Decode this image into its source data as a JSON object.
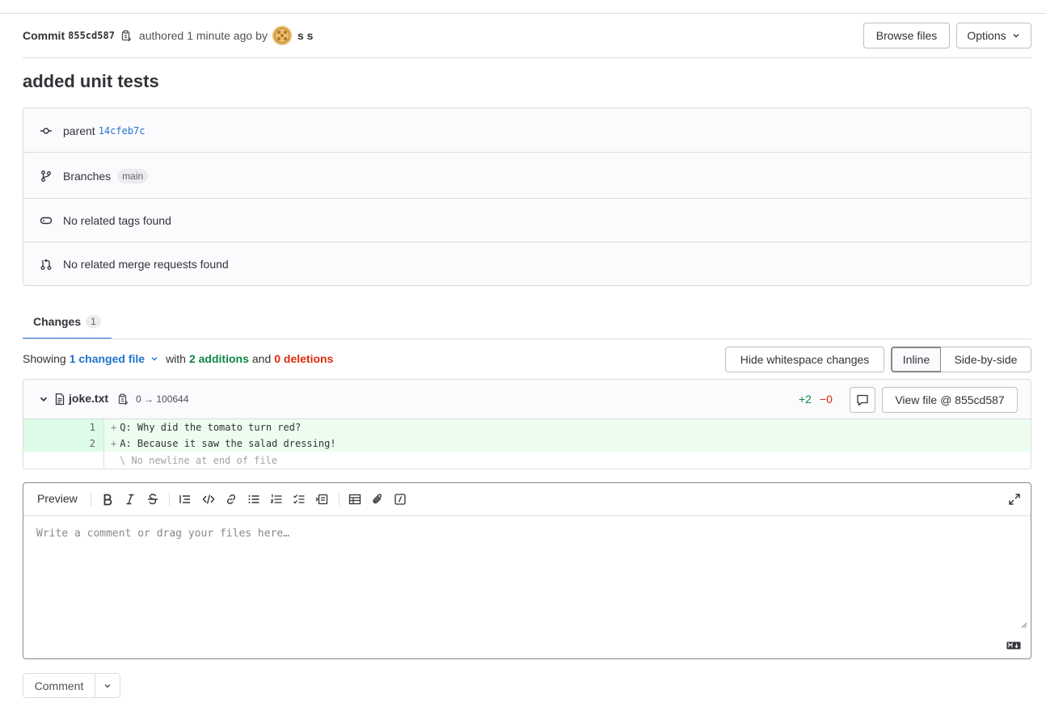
{
  "header": {
    "commit_label": "Commit",
    "commit_sha": "855cd587",
    "authored_text": "authored",
    "time_ago": "1 minute ago",
    "by_text": "by",
    "author": "s s",
    "browse_files": "Browse files",
    "options": "Options"
  },
  "commit_title": "added unit tests",
  "info": {
    "parent_label": "parent",
    "parent_sha": "14cfeb7c",
    "branches_label": "Branches",
    "branch": "main",
    "tags_text": "No related tags found",
    "mr_text": "No related merge requests found"
  },
  "tabs": [
    {
      "label": "Changes",
      "count": "1"
    }
  ],
  "summary": {
    "showing": "Showing",
    "changed_files": "1 changed file",
    "with": "with",
    "additions": "2 additions",
    "and": "and",
    "deletions": "0 deletions",
    "hide_whitespace": "Hide whitespace changes",
    "view_inline": "Inline",
    "view_side": "Side-by-side"
  },
  "diff": {
    "filename": "joke.txt",
    "mode": "0 → 100644",
    "stat_added": "+2",
    "stat_removed": "−0",
    "view_file": "View file @ 855cd587",
    "lines": [
      {
        "num": "1",
        "sign": "+",
        "text": "Q: Why did the tomato turn red?"
      },
      {
        "num": "2",
        "sign": "+",
        "text": "A: Because it saw the salad dressing!"
      }
    ],
    "no_newline": "\\ No newline at end of file"
  },
  "editor": {
    "preview_tab": "Preview",
    "placeholder": "Write a comment or drag your files here…"
  },
  "comment_button": "Comment",
  "colors": {
    "link": "#1f75cb",
    "addition": "#108548",
    "deletion": "#dd2b0e",
    "added_line_bg": "#ecfdf0"
  }
}
